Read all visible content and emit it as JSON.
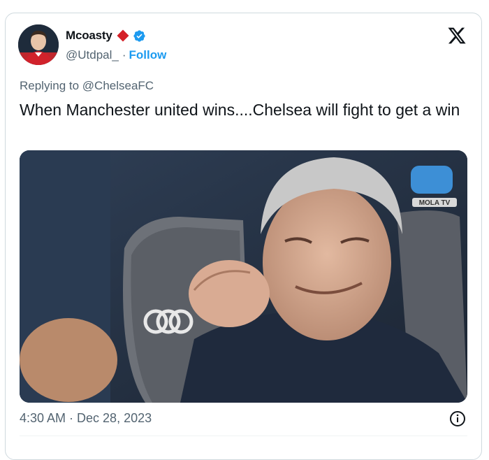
{
  "tweet": {
    "author": {
      "name": "Mcoasty",
      "handle": "@Utdpal_"
    },
    "follow_separator": "·",
    "follow_label": "Follow",
    "reply_prefix": "Replying to",
    "reply_to": "@ChelseaFC",
    "text": "When Manchester united wins....Chelsea will fight to get a win",
    "media": {
      "watermark": "MOLA TV",
      "description_icon": "photo"
    },
    "timestamp": "4:30 AM · Dec 28, 2023"
  },
  "icons": {
    "platform": "x-logo-icon",
    "badge": "verified-badge-icon",
    "flair": "red-diamond-icon",
    "info": "info-icon"
  },
  "colors": {
    "accent": "#1d9bf0",
    "secondary_text": "#536471",
    "diamond": "#d42027",
    "border": "#cfd9de"
  }
}
